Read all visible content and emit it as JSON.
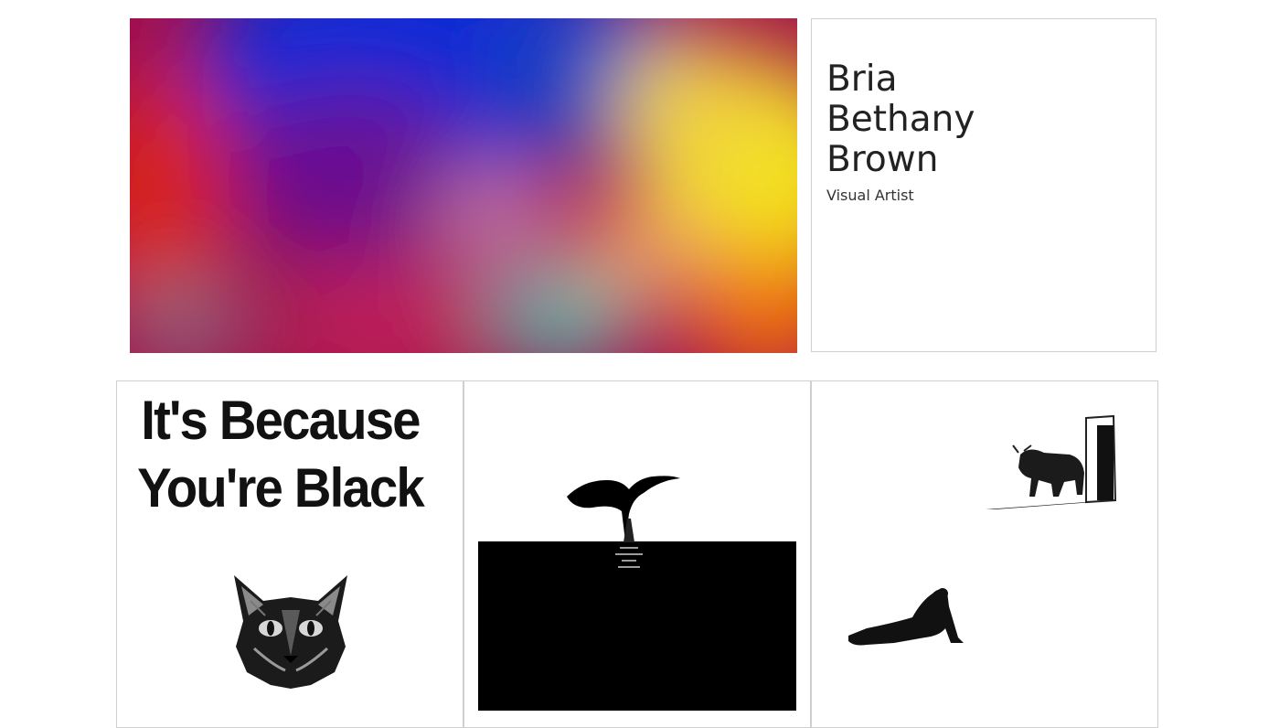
{
  "artist": {
    "name_lines": [
      "Bria",
      "Bethany",
      "Brown"
    ],
    "role": "Visual Artist"
  },
  "gallery": {
    "poster": {
      "line1": "It's Because",
      "line2": "You're Black"
    }
  },
  "colors": {
    "card_border": "#cfcfcf",
    "text": "#222222"
  }
}
